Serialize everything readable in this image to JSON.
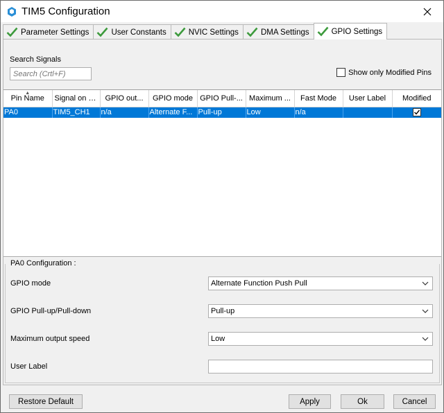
{
  "window": {
    "title": "TIM5 Configuration"
  },
  "tabs": [
    {
      "label": "Parameter Settings",
      "active": false
    },
    {
      "label": "User Constants",
      "active": false
    },
    {
      "label": "NVIC Settings",
      "active": false
    },
    {
      "label": "DMA Settings",
      "active": false
    },
    {
      "label": "GPIO Settings",
      "active": true
    }
  ],
  "search": {
    "label": "Search Signals",
    "placeholder": "Search (Crtl+F)"
  },
  "filter": {
    "label": "Show only Modified Pins",
    "checked": false
  },
  "table": {
    "columns": [
      "Pin Name",
      "Signal on Pin",
      "GPIO out...",
      "GPIO mode",
      "GPIO Pull-...",
      "Maximum ...",
      "Fast Mode",
      "User Label",
      "Modified"
    ],
    "rows": [
      {
        "pin": "PA0",
        "signal": "TIM5_CH1",
        "gpio_out": "n/a",
        "gpio_mode": "Alternate F...",
        "pull": "Pull-up",
        "max_speed": "Low",
        "fast_mode": "n/a",
        "user_label": "",
        "modified": true
      }
    ]
  },
  "config": {
    "title": "PA0 Configuration :",
    "fields": [
      {
        "label": "GPIO mode",
        "value": "Alternate Function Push Pull"
      },
      {
        "label": "GPIO Pull-up/Pull-down",
        "value": "Pull-up"
      },
      {
        "label": "Maximum output speed",
        "value": "Low"
      },
      {
        "label": "User Label",
        "value": ""
      }
    ]
  },
  "buttons": {
    "restore": "Restore Default",
    "apply": "Apply",
    "ok": "Ok",
    "cancel": "Cancel"
  },
  "colors": {
    "selection": "#0078d7",
    "check_green": "#3c9a3c",
    "app_icon": "#2a8fd6"
  }
}
